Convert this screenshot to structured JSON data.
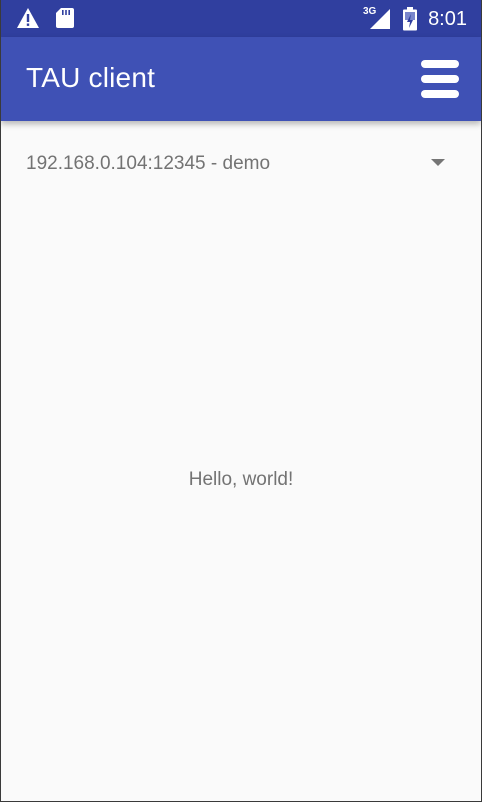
{
  "status_bar": {
    "network_type": "3G",
    "time": "8:01",
    "icons": [
      "warning-icon",
      "sdcard-icon",
      "signal-icon",
      "battery-icon"
    ],
    "background_color": "#303f9f"
  },
  "app_bar": {
    "title": "TAU client",
    "menu_icon": "hamburger-menu-icon",
    "background_color": "#3f51b5"
  },
  "connection_spinner": {
    "selected_value": "192.168.0.104:12345 - demo",
    "arrow_icon": "dropdown-arrow-icon"
  },
  "main": {
    "message": "Hello, world!"
  }
}
